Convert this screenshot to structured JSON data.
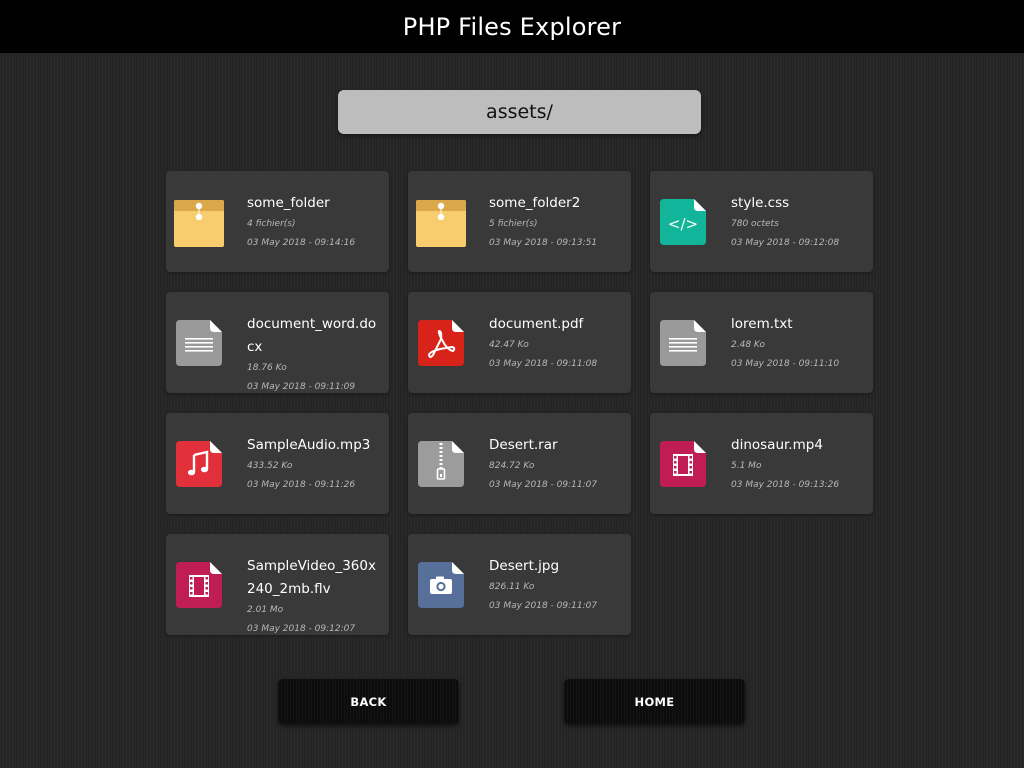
{
  "header": {
    "title": "PHP Files Explorer"
  },
  "path": {
    "current": "assets/"
  },
  "files": [
    {
      "name": "some_folder",
      "detail": "4 fichier(s)",
      "date": "03 May 2018 - 09:14:16",
      "icon": "folder-icon"
    },
    {
      "name": "some_folder2",
      "detail": "5 fichier(s)",
      "date": "03 May 2018 - 09:13:51",
      "icon": "folder-icon"
    },
    {
      "name": "style.css",
      "detail": "780 octets",
      "date": "03 May 2018 - 09:12:08",
      "icon": "code-file-icon"
    },
    {
      "name": "document_word.docx",
      "detail": "18.76 Ko",
      "date": "03 May 2018 - 09:11:09",
      "icon": "text-file-icon"
    },
    {
      "name": "document.pdf",
      "detail": "42.47 Ko",
      "date": "03 May 2018 - 09:11:08",
      "icon": "pdf-file-icon"
    },
    {
      "name": "lorem.txt",
      "detail": "2.48 Ko",
      "date": "03 May 2018 - 09:11:10",
      "icon": "text-file-icon"
    },
    {
      "name": "SampleAudio.mp3",
      "detail": "433.52 Ko",
      "date": "03 May 2018 - 09:11:26",
      "icon": "audio-file-icon"
    },
    {
      "name": "Desert.rar",
      "detail": "824.72 Ko",
      "date": "03 May 2018 - 09:11:07",
      "icon": "archive-file-icon"
    },
    {
      "name": "dinosaur.mp4",
      "detail": "5.1 Mo",
      "date": "03 May 2018 - 09:13:26",
      "icon": "video-file-icon"
    },
    {
      "name": "SampleVideo_360x240_2mb.flv",
      "detail": "2.01 Mo",
      "date": "03 May 2018 - 09:12:07",
      "icon": "video-file-icon"
    },
    {
      "name": "Desert.jpg",
      "detail": "826.11 Ko",
      "date": "03 May 2018 - 09:11:07",
      "icon": "image-file-icon"
    }
  ],
  "buttons": {
    "back": "BACK",
    "home": "HOME"
  },
  "colors": {
    "header_bg": "#000000",
    "page_bg": "#252525",
    "card_bg": "#393939",
    "path_bar_bg": "#bdbdbd",
    "folder": "#f8cd6e",
    "folder_flap": "#dba84a",
    "css_file": "#13b59a",
    "text_file": "#9a9a9a",
    "pdf_file": "#d8231b",
    "audio_file": "#e2303a",
    "archive_file": "#9c9c9c",
    "video_file": "#c01d54",
    "image_file": "#56709a"
  }
}
